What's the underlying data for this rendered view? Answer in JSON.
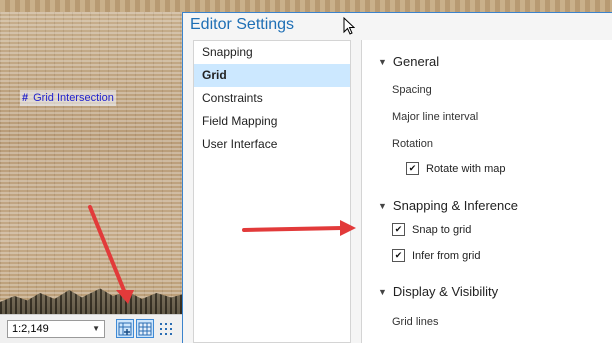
{
  "map": {
    "grid_label": "Grid Intersection",
    "grid_icon": "#"
  },
  "statusbar": {
    "scale_value": "1:2,149"
  },
  "window": {
    "title": "Editor Settings"
  },
  "nav": {
    "items": [
      {
        "label": "Snapping"
      },
      {
        "label": "Grid"
      },
      {
        "label": "Constraints"
      },
      {
        "label": "Field Mapping"
      },
      {
        "label": "User Interface"
      }
    ],
    "selected": "Grid"
  },
  "panel": {
    "general": {
      "heading": "General",
      "spacing_label": "Spacing",
      "major_line_label": "Major line interval",
      "rotation_label": "Rotation",
      "rotate_with_map": {
        "label": "Rotate with map",
        "checked": true
      }
    },
    "snapping": {
      "heading": "Snapping & Inference",
      "snap_to_grid": {
        "label": "Snap to grid",
        "checked": true
      },
      "infer_from_grid": {
        "label": "Infer from grid",
        "checked": true
      }
    },
    "display": {
      "heading": "Display & Visibility",
      "grid_lines_label": "Grid lines"
    }
  },
  "colors": {
    "accent": "#1e6fb5",
    "selection": "#cce8ff",
    "annotation_arrow": "#e23a3a",
    "grid_label": "#2222cc"
  }
}
